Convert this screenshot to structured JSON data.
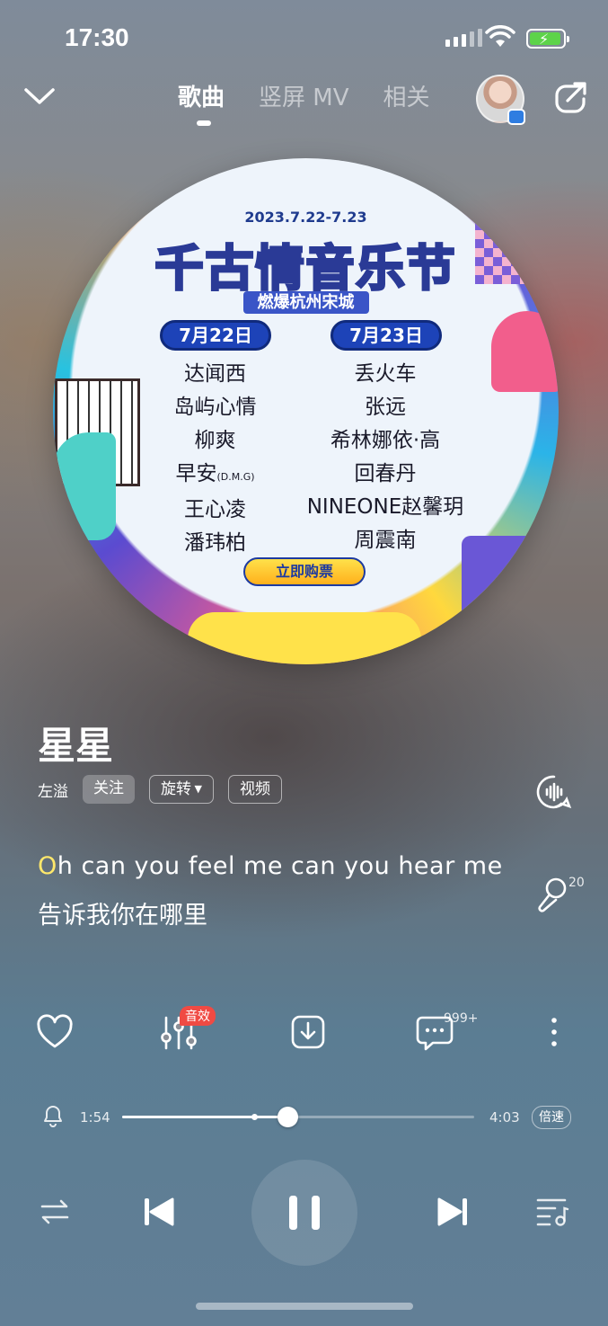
{
  "status_bar": {
    "time": "17:30"
  },
  "nav": {
    "tabs": [
      {
        "label": "歌曲",
        "active": true
      },
      {
        "label": "竖屏 MV",
        "active": false
      },
      {
        "label": "相关",
        "active": false
      }
    ]
  },
  "cover": {
    "date": "2023.7.22-7.23",
    "title": "千古情音乐节",
    "subtitle": "燃爆杭州宋城",
    "day1": {
      "label": "7月22日",
      "artists": [
        "达闻西",
        "岛屿心情",
        "柳爽",
        "早安",
        "王心凌",
        "潘玮柏"
      ],
      "note": "(D.M.G)"
    },
    "day2": {
      "label": "7月23日",
      "artists": [
        "丢火车",
        "张远",
        "希林娜依·高",
        "回春丹",
        "NINEONE赵馨玥",
        "周震南"
      ]
    },
    "ticket_button": "立即购票"
  },
  "song": {
    "title": "星星",
    "artist": "左溢",
    "follow": "关注",
    "tag": "旋转",
    "video": "视频"
  },
  "lyrics": {
    "line_en_highlight": "O",
    "line_en_rest": "h can you feel me can you hear me",
    "line_zh": "告诉我你在哪里"
  },
  "mic_count": "20",
  "actions": {
    "effect_badge": "音效",
    "comment_count": "999+"
  },
  "progress": {
    "current": "1:54",
    "total": "4:03",
    "fraction": 0.47,
    "speed_label": "倍速"
  },
  "colors": {
    "accent_yellow": "#ffe86b",
    "badge_red": "#f04a43",
    "battery_green": "#5dd34a"
  }
}
